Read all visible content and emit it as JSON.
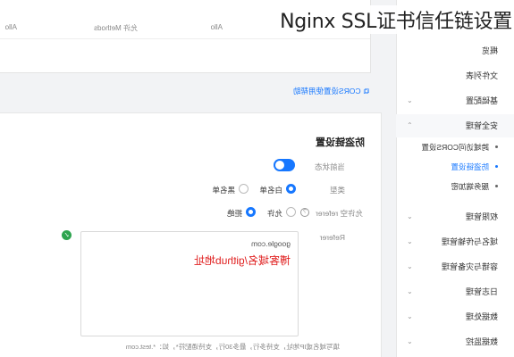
{
  "overlay_title": "Nginx SSL证书信任链设置",
  "top_table": {
    "headers": [
      "Allo",
      "允许 Methods",
      "Allo"
    ]
  },
  "cors_link": "CORS设置使用帮助",
  "sidebar": {
    "items": [
      {
        "label": "概览"
      },
      {
        "label": "文件列表"
      },
      {
        "label": "基础配置"
      },
      {
        "label": "安全管理"
      },
      {
        "label": "权限管理"
      },
      {
        "label": "域名与传输管理"
      },
      {
        "label": "容错与灾备管理"
      },
      {
        "label": "日志管理"
      },
      {
        "label": "数据处理"
      },
      {
        "label": "数据监控"
      }
    ],
    "subitems": [
      {
        "label": "跨域访问CORS设置"
      },
      {
        "label": "防盗链设置"
      },
      {
        "label": "服务端加密"
      }
    ]
  },
  "hotlink": {
    "title": "防盗链设置",
    "status_label": "当前状态",
    "type_label": "类型",
    "type_options": [
      "白名单",
      "黑名单"
    ],
    "empty_referer_label": "允许空 referer",
    "empty_referer_options": [
      "允许",
      "拒绝"
    ],
    "referer_label": "Referer",
    "textarea_line": "google.com",
    "textarea_overlay": "博客域名/github地址",
    "hint": "填写域名或IP地址，支持多行，最多30行，支持通配符*，如：*.test.com"
  },
  "colors": {
    "accent": "#1677ff",
    "annotation_red": "#e02020",
    "success_green": "#2ea44f"
  }
}
